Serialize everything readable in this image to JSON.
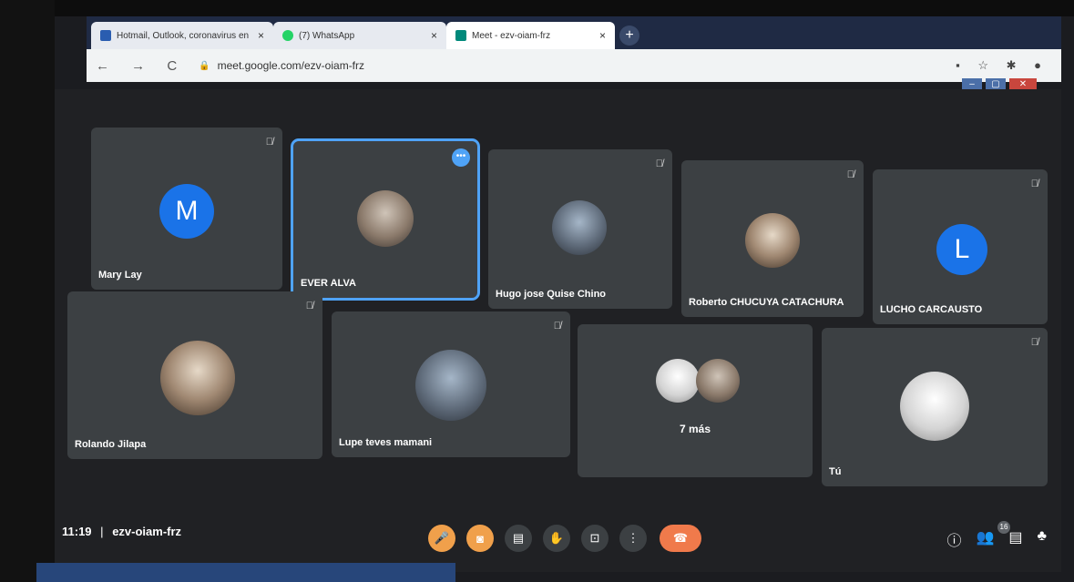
{
  "browser": {
    "tabs": [
      {
        "label": "Hotmail, Outlook, coronavirus en",
        "close": "×",
        "icon_color": "#2a5db0"
      },
      {
        "label": "(7) WhatsApp",
        "close": "×",
        "icon_color": "#25d366"
      },
      {
        "label": "Meet - ezv-oiam-frz",
        "close": "×",
        "icon_color": "#00897b"
      }
    ],
    "new_tab": "+",
    "nav": "← → C",
    "lock_icon": "lock-icon",
    "url": "meet.google.com/ezv-oiam-frz",
    "toolbar_icons": "▪ ☆ ✱ ●",
    "window_buttons": [
      "–",
      "▢",
      "✕"
    ]
  },
  "participants": [
    {
      "name": "Mary Lay",
      "initial": "M",
      "muted": "mic-off-icon"
    },
    {
      "name": "EVER ALVA",
      "initial": "",
      "more": "•••"
    },
    {
      "name": "Hugo jose Quise Chino",
      "initial": "",
      "muted": "mic-off-icon"
    },
    {
      "name": "Roberto CHUCUYA CATACHURA",
      "initial": "",
      "muted": "mic-off-icon"
    },
    {
      "name": "LUCHO CARCAUSTO",
      "initial": "L",
      "muted": "mic-off-icon"
    },
    {
      "name": "Rolando Jilapa",
      "initial": "",
      "muted": "mic-off-icon"
    },
    {
      "name": "Lupe teves mamani",
      "initial": "",
      "muted": "mic-off-icon"
    },
    {
      "name": "7 más",
      "initial": ""
    },
    {
      "name": "Tú",
      "initial": "",
      "muted": "mic-off-icon"
    }
  ],
  "meeting": {
    "time": "11:19",
    "separator": "|",
    "code": "ezv-oiam-frz"
  },
  "controls": {
    "mic_icon": "🎤",
    "cam_icon": "◙",
    "captions_icon": "▤",
    "hand_icon": "✋",
    "present_icon": "⊡",
    "more_icon": "⋮",
    "hangup_icon": "☎"
  },
  "right_panel": {
    "info_icon": "ⓘ",
    "people_icon": "👥",
    "people_count": "16",
    "chat_icon": "▤",
    "activities_icon": "♣"
  },
  "colors": {
    "accent": "#4fa3f7",
    "orange": "#f0a04b",
    "hangup": "#f07a4b",
    "avatar_blue": "#1a73e8"
  }
}
